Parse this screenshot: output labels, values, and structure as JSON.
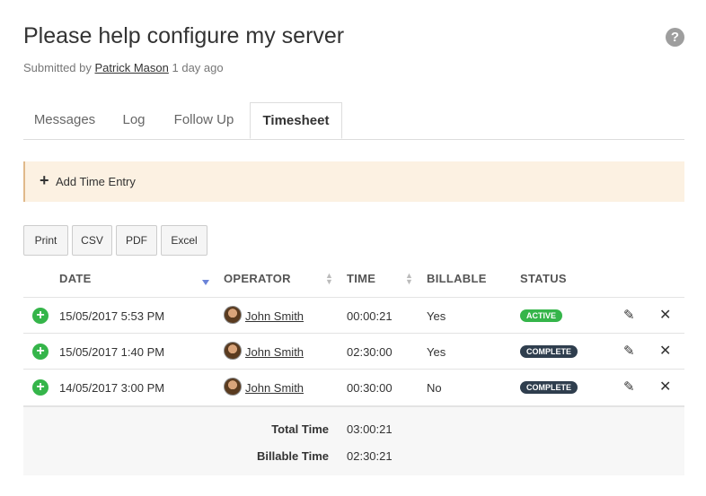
{
  "header": {
    "title": "Please help configure my server",
    "submitted_by_prefix": "Submitted by",
    "author": "Patrick Mason",
    "time_ago": "1 day ago",
    "help_glyph": "?"
  },
  "tabs": [
    {
      "label": "Messages",
      "active": false
    },
    {
      "label": "Log",
      "active": false
    },
    {
      "label": "Follow Up",
      "active": false
    },
    {
      "label": "Timesheet",
      "active": true
    }
  ],
  "add_entry": {
    "label": "Add Time Entry",
    "icon": "plus-icon"
  },
  "export_buttons": [
    "Print",
    "CSV",
    "PDF",
    "Excel"
  ],
  "table": {
    "columns": [
      "DATE",
      "OPERATOR",
      "TIME",
      "BILLABLE",
      "STATUS"
    ],
    "rows": [
      {
        "date": "15/05/2017 5:53 PM",
        "operator": "John Smith",
        "time": "00:00:21",
        "billable": "Yes",
        "status": "ACTIVE"
      },
      {
        "date": "15/05/2017 1:40 PM",
        "operator": "John Smith",
        "time": "02:30:00",
        "billable": "Yes",
        "status": "COMPLETE"
      },
      {
        "date": "14/05/2017 3:00 PM",
        "operator": "John Smith",
        "time": "00:30:00",
        "billable": "No",
        "status": "COMPLETE"
      }
    ]
  },
  "totals": {
    "total_label": "Total Time",
    "total_value": "03:00:21",
    "billable_label": "Billable Time",
    "billable_value": "02:30:21"
  },
  "colors": {
    "active_badge": "#35b54a",
    "complete_badge": "#2f3e4e",
    "add_icon": "#35b54a",
    "notice_bg": "#fcf1e2",
    "sort_active": "#6b84d8"
  }
}
